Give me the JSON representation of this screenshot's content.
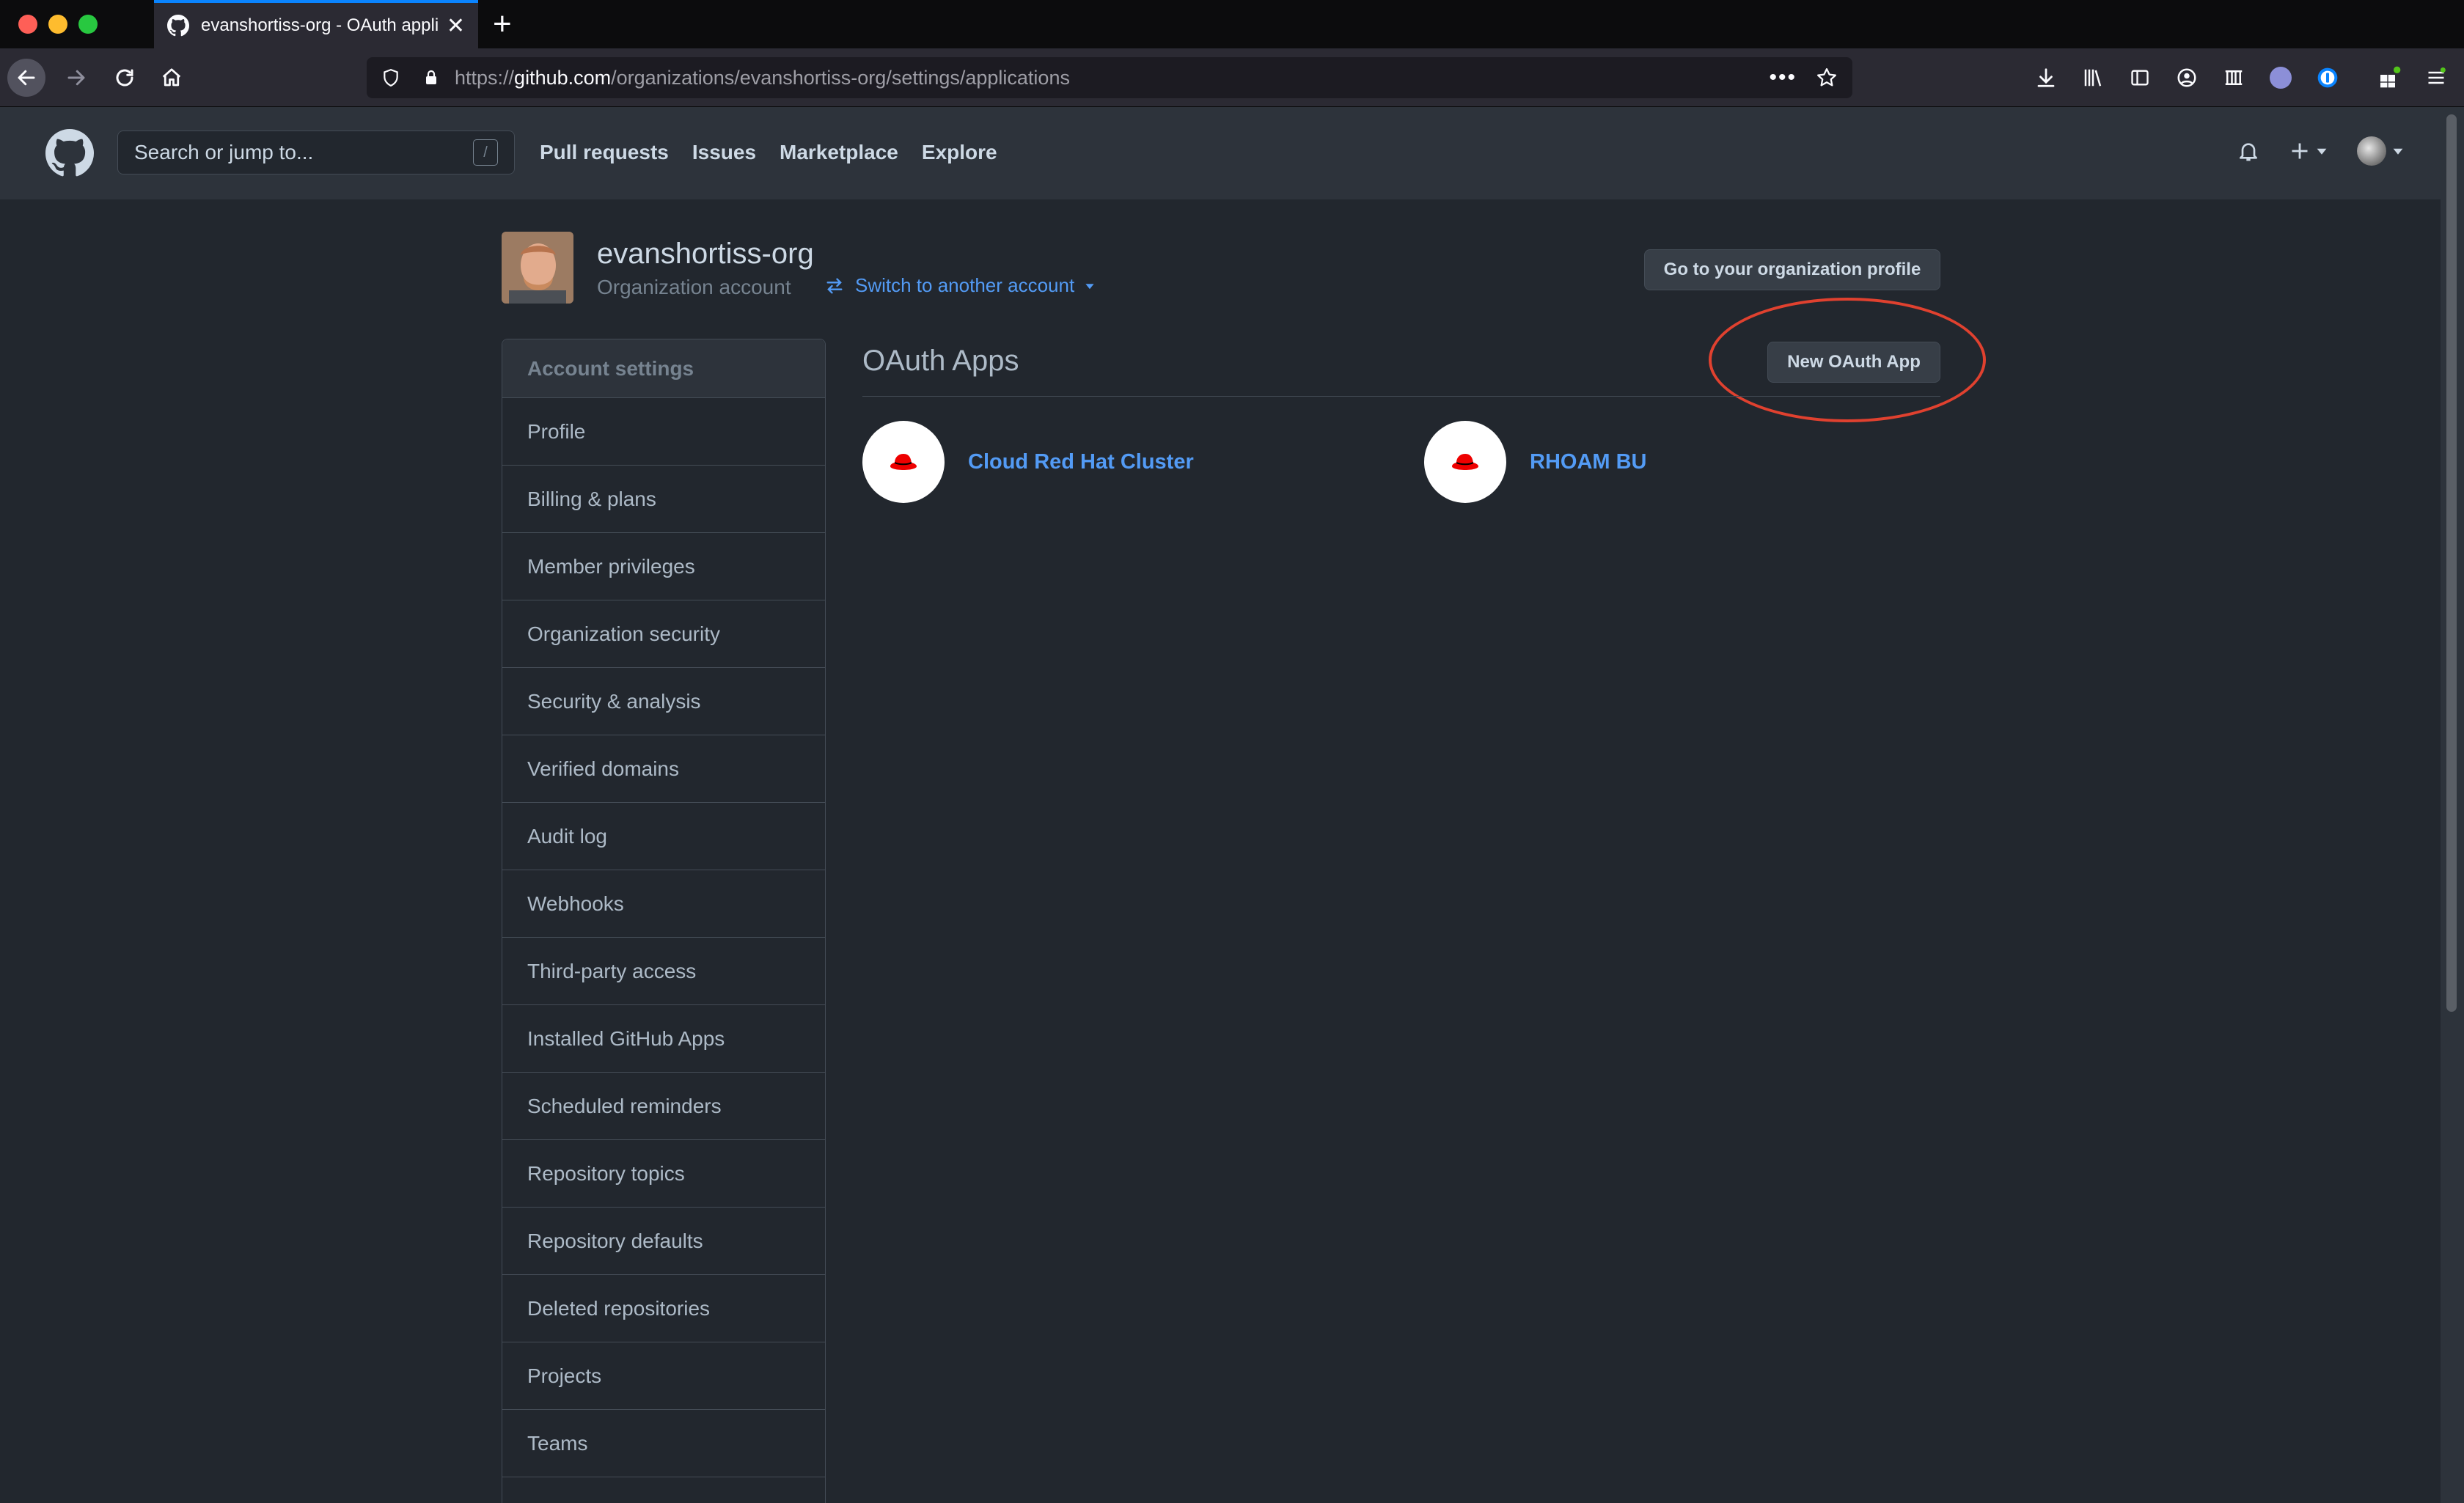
{
  "browser": {
    "tab_title": "evanshortiss-org - OAuth appli",
    "url_prefix": "https://",
    "url_host": "github.com",
    "url_path": "/organizations/evanshortiss-org/settings/applications"
  },
  "header": {
    "search_placeholder": "Search or jump to...",
    "search_shortcut": "/",
    "nav": [
      "Pull requests",
      "Issues",
      "Marketplace",
      "Explore"
    ]
  },
  "org": {
    "name": "evanshortiss-org",
    "type": "Organization account",
    "switch_label": "Switch to another account",
    "profile_button": "Go to your organization profile"
  },
  "sidebar": {
    "heading": "Account settings",
    "items": [
      "Profile",
      "Billing & plans",
      "Member privileges",
      "Organization security",
      "Security & analysis",
      "Verified domains",
      "Audit log",
      "Webhooks",
      "Third-party access",
      "Installed GitHub Apps",
      "Scheduled reminders",
      "Repository topics",
      "Repository defaults",
      "Deleted repositories",
      "Projects",
      "Teams"
    ]
  },
  "main": {
    "title": "OAuth Apps",
    "new_button": "New OAuth App",
    "apps": [
      "Cloud Red Hat Cluster",
      "RHOAM BU"
    ]
  },
  "colors": {
    "background": "#22272e",
    "header": "#2d333b",
    "link": "#539bf5",
    "highlight": "#e0412f",
    "redhat": "#ee0000"
  }
}
